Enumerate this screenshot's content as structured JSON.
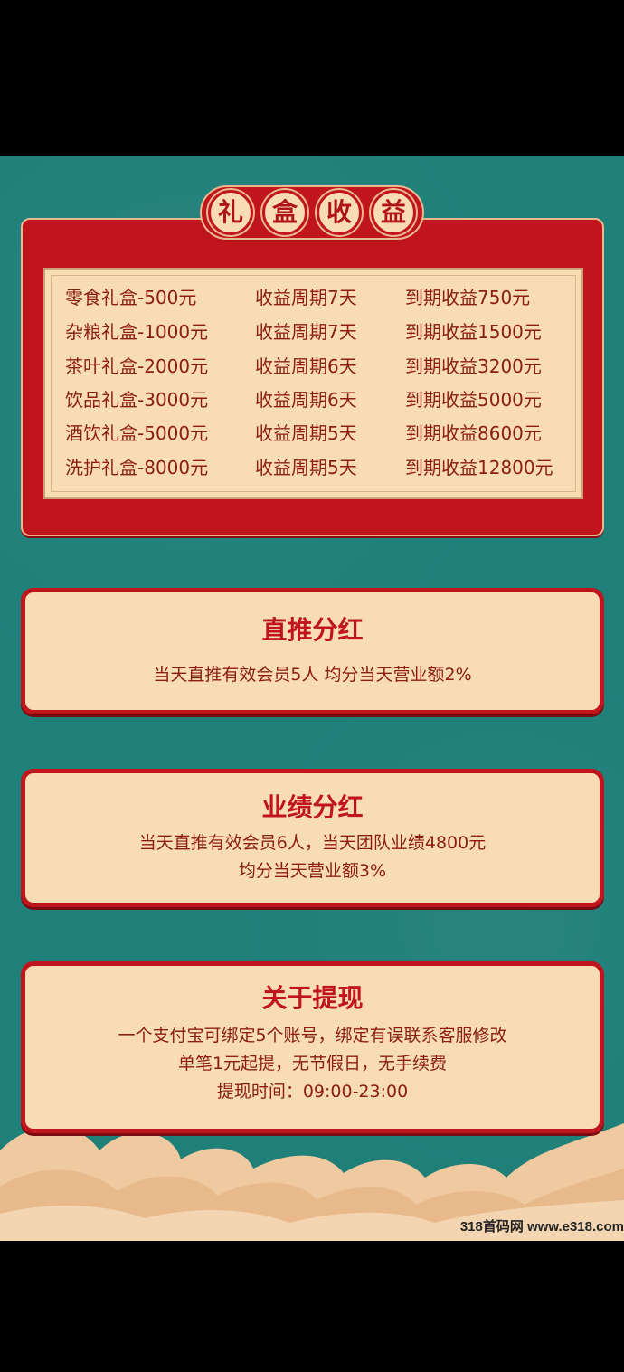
{
  "gift_box": {
    "title_chars": [
      "礼",
      "盒",
      "收",
      "益"
    ],
    "rows": [
      {
        "name": "零食礼盒-500元",
        "period": "收益周期7天",
        "return": "到期收益750元"
      },
      {
        "name": "杂粮礼盒-1000元",
        "period": "收益周期7天",
        "return": "到期收益1500元"
      },
      {
        "name": "茶叶礼盒-2000元",
        "period": "收益周期6天",
        "return": "到期收益3200元"
      },
      {
        "name": "饮品礼盒-3000元",
        "period": "收益周期6天",
        "return": "到期收益5000元"
      },
      {
        "name": "酒饮礼盒-5000元",
        "period": "收益周期5天",
        "return": "到期收益8600元"
      },
      {
        "name": "洗护礼盒-8000元",
        "period": "收益周期5天",
        "return": "到期收益12800元"
      }
    ]
  },
  "direct_dividend": {
    "title": "直推分红",
    "lines": [
      "当天直推有效会员5人 均分当天营业额2%"
    ]
  },
  "performance_dividend": {
    "title": "业绩分红",
    "lines": [
      "当天直推有效会员6人，当天团队业绩4800元",
      "均分当天营业额3%"
    ]
  },
  "withdrawal": {
    "title": "关于提现",
    "lines": [
      "一个支付宝可绑定5个账号，绑定有误联系客服修改",
      "单笔1元起提，无节假日，无手续费",
      "提现时间：09:00-23:00"
    ]
  },
  "watermark": "318首码网 www.e318.com",
  "colors": {
    "teal": "#1f7f79",
    "red": "#c1151e",
    "cream": "#f8dcb4",
    "text": "#8b1d14"
  }
}
